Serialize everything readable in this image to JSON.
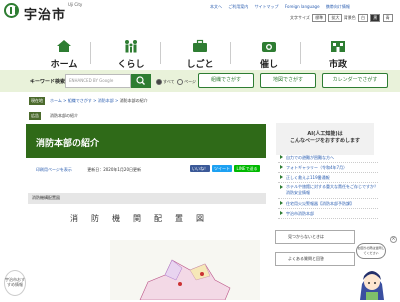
{
  "header": {
    "city_name": "宇治市",
    "city_en": "Uji City",
    "top_links": [
      "本文へ",
      "ご利用案内",
      "サイトマップ",
      "Foreign language",
      "携帯向け情報"
    ],
    "font_size_label": "文字サイズ",
    "font_sizes": [
      "標準",
      "拡大"
    ],
    "bg_label": "背景色",
    "bg_options": [
      "白",
      "黒",
      "青"
    ]
  },
  "nav": {
    "items": [
      {
        "label": "ホーム"
      },
      {
        "label": "くらし"
      },
      {
        "label": "しごと"
      },
      {
        "label": "催し"
      },
      {
        "label": "市政"
      }
    ]
  },
  "search": {
    "label": "キーワード検索",
    "placeholder": "ENHANCED BY Google",
    "radios": [
      "すべて",
      "ページ",
      "PDF"
    ],
    "quick": [
      "組織でさがす",
      "地図でさがす",
      "カレンダーでさがす"
    ]
  },
  "breadcrumb": {
    "tag": "現在地",
    "items": [
      "ホーム",
      "組織でさがす",
      "消防本部",
      "消防本部の紹介"
    ]
  },
  "ad": {
    "tag": "広告",
    "text": "消防本部の紹介"
  },
  "page": {
    "title": "消防本部の紹介",
    "print_link": "印刷用ページを表示",
    "updated": "更新日：2020年1月20日更新",
    "sns": [
      "いいね！",
      "ツイート",
      "LINEで送る"
    ],
    "section_label": "消防機構配置図",
    "doc_title": "消防機関配置図"
  },
  "sidebar": {
    "heading_1": "AI(人工知能)は",
    "heading_2": "こんなページをおすすめします",
    "items": [
      "自力での避難が困難な方へ",
      "フォトギャラリー（令和4年7月）",
      "正しく救えよ119番通報",
      "ホテルや旅館に対する重大な責任をご存じですか？消防安全情報",
      "住宅用火災警報器【消防本部予防課】",
      "宇治市消防本部"
    ],
    "faq_1": "見つからないときは",
    "faq_2": "よくある質問と回答",
    "bubble": "お困りの際は質問してください",
    "close": "×"
  },
  "bottom_left": {
    "text": "宇治市おすすめ情報"
  },
  "colors": {
    "brand_green": "#2e7d32",
    "title_green": "#2f6a18",
    "link_blue": "#2a5db0"
  }
}
